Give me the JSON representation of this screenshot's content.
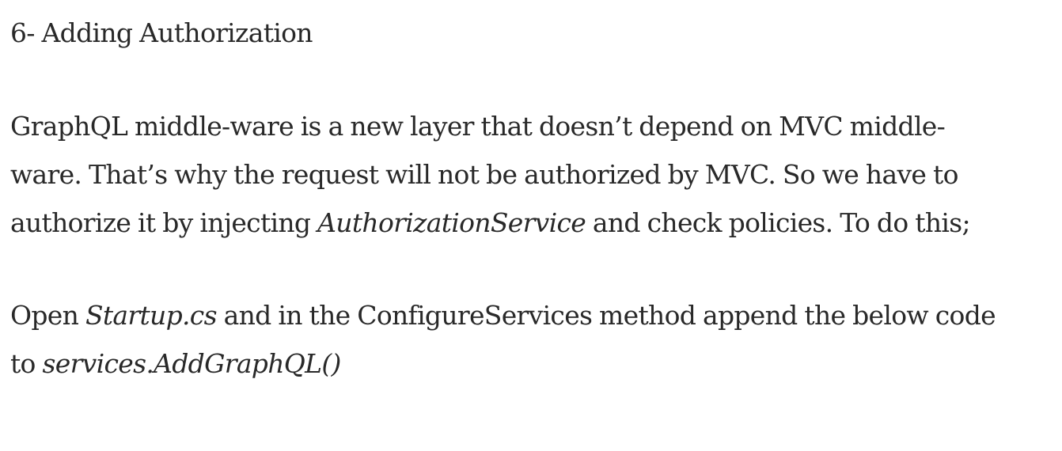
{
  "heading": "6- Adding Authorization",
  "paragraph1": {
    "line1": "GraphQL middle-ware is a new layer that doesn’t depend on MVC middle-",
    "line2": "ware. That’s why the request will not be authorized by MVC. So we have to",
    "line3_before": "authorize it by injecting ",
    "line3_em": "AuthorizationService",
    "line3_after": " and check policies. To do this;"
  },
  "paragraph2": {
    "line1_before": "Open ",
    "line1_em": "Startup.cs",
    "line1_after": " and in the ConfigureServices method append the below code",
    "line2_before": "to ",
    "line2_em": "services.AddGraphQL()"
  }
}
